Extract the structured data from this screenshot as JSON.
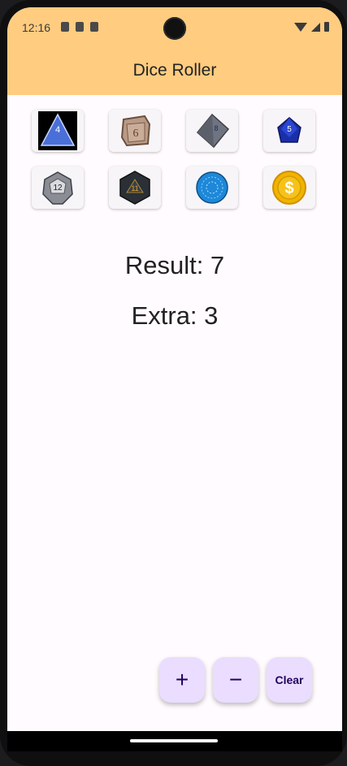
{
  "status": {
    "time": "12:16"
  },
  "appbar": {
    "title": "Dice Roller",
    "color": "#ffcc80"
  },
  "dice": [
    {
      "name": "d4",
      "icon": "d4-die-icon",
      "face": "4"
    },
    {
      "name": "d6",
      "icon": "d6-die-icon",
      "face": "6"
    },
    {
      "name": "d8",
      "icon": "d8-die-icon",
      "face": "8"
    },
    {
      "name": "d10",
      "icon": "d10-die-icon",
      "face": "5"
    },
    {
      "name": "d12",
      "icon": "d12-die-icon",
      "face": "12"
    },
    {
      "name": "d20",
      "icon": "d20-die-icon",
      "face": "11"
    },
    {
      "name": "d100",
      "icon": "d100-die-icon",
      "face": ""
    },
    {
      "name": "coin",
      "icon": "coin-icon",
      "face": "$"
    }
  ],
  "main": {
    "result_text": "Result: 7",
    "extra_text": "Extra: 3"
  },
  "fabs": {
    "plus_label": "+",
    "minus_label": "−",
    "clear_label": "Clear",
    "color": "#eaddff"
  }
}
